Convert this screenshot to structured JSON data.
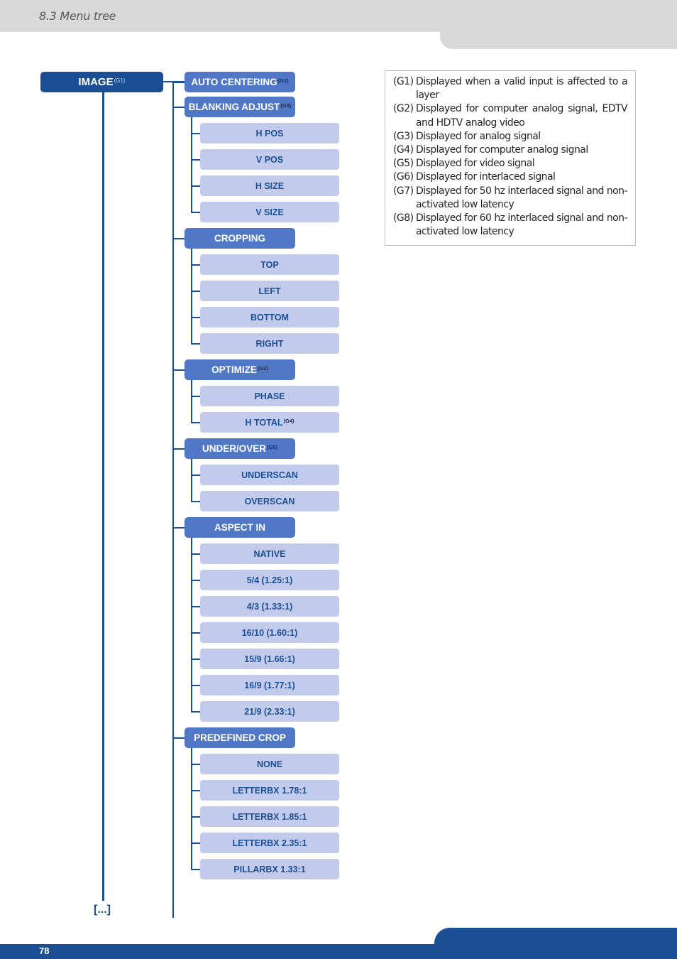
{
  "header": {
    "section_title": "8.3 Menu tree"
  },
  "footer": {
    "page_number": "78"
  },
  "colors": {
    "root": "#1a4f93",
    "level1": "#5078c6",
    "level2": "#c3cbec",
    "level2_text": "#1a4f93",
    "header_band": "#d9d9d9",
    "footer_band": "#1a4f93"
  },
  "tree": {
    "root": {
      "label": "IMAGE",
      "note": "(G1)"
    },
    "continuation": "[...]",
    "items": [
      {
        "label": "AUTO CENTERING",
        "note": "(G2)",
        "children": []
      },
      {
        "label": "BLANKING ADJUST",
        "note": "(G3)",
        "children": [
          {
            "label": "H POS"
          },
          {
            "label": "V POS"
          },
          {
            "label": "H SIZE"
          },
          {
            "label": "V SIZE"
          }
        ]
      },
      {
        "label": "CROPPING",
        "note": "",
        "children": [
          {
            "label": "TOP"
          },
          {
            "label": "LEFT"
          },
          {
            "label": "BOTTOM"
          },
          {
            "label": "RIGHT"
          }
        ]
      },
      {
        "label": "OPTIMIZE",
        "note": "(G2)",
        "children": [
          {
            "label": "PHASE"
          },
          {
            "label": "H TOTAL",
            "note": "(G4)"
          }
        ]
      },
      {
        "label": "UNDER/OVER",
        "note": "(G5)",
        "children": [
          {
            "label": "UNDERSCAN"
          },
          {
            "label": "OVERSCAN"
          }
        ]
      },
      {
        "label": "ASPECT IN",
        "note": "",
        "children": [
          {
            "label": "NATIVE"
          },
          {
            "label": "5/4 (1.25:1)"
          },
          {
            "label": "4/3 (1.33:1)"
          },
          {
            "label": "16/10 (1.60:1)"
          },
          {
            "label": "15/9 (1.66:1)"
          },
          {
            "label": "16/9 (1.77:1)"
          },
          {
            "label": "21/9 (2.33:1)"
          }
        ]
      },
      {
        "label": "PREDEFINED CROP",
        "note": "",
        "children": [
          {
            "label": "NONE"
          },
          {
            "label": "LETTERBX 1.78:1"
          },
          {
            "label": "LETTERBX 1.85:1"
          },
          {
            "label": "LETTERBX 2.35:1"
          },
          {
            "label": "PILLARBX 1.33:1"
          }
        ]
      }
    ]
  },
  "legend": [
    {
      "code": "(G1)",
      "text": "Displayed when a valid input is affected to a layer"
    },
    {
      "code": "(G2)",
      "text": "Displayed for computer analog signal, EDTV and HDTV analog video"
    },
    {
      "code": "(G3)",
      "text": "Displayed for analog signal"
    },
    {
      "code": "(G4)",
      "text": "Displayed for computer analog signal"
    },
    {
      "code": "(G5)",
      "text": "Displayed for video signal"
    },
    {
      "code": "(G6)",
      "text": "Displayed for interlaced signal"
    },
    {
      "code": "(G7)",
      "text": "Displayed for 50 hz interlaced signal and non-activated low latency"
    },
    {
      "code": "(G8)",
      "text": "Displayed for 60 hz interlaced signal and non-activated low latency"
    }
  ]
}
